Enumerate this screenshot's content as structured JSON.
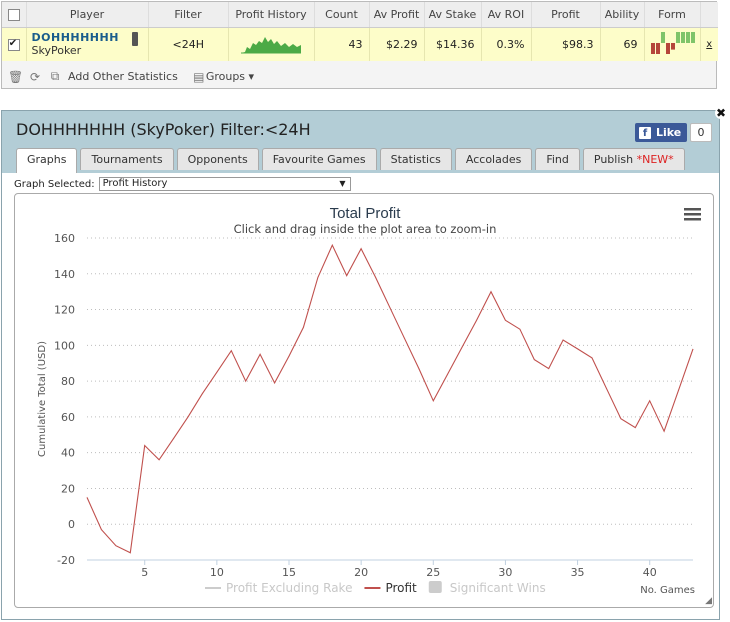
{
  "table": {
    "headers": [
      "",
      "Player",
      "Filter",
      "Profit History",
      "Count",
      "Av Profit",
      "Av Stake",
      "Av ROI",
      "Profit",
      "Ability",
      "Form",
      ""
    ],
    "row": {
      "player_name": "DOHHHHHHH",
      "player_site": "SkyPoker",
      "filter": "<24H",
      "count": "43",
      "av_profit": "$2.29",
      "av_stake": "$14.36",
      "av_roi": "0.3%",
      "profit": "$98.3",
      "ability": "69",
      "remove": "x",
      "form_bars": [
        {
          "value": -1,
          "color": "#b5453a"
        },
        {
          "value": -1,
          "color": "#b5453a"
        },
        {
          "value": 1,
          "color": "#7fc46a"
        },
        {
          "value": -1,
          "color": "#b5453a"
        },
        {
          "value": -0.6,
          "color": "#b5453a"
        },
        {
          "value": 1,
          "color": "#7fc46a"
        },
        {
          "value": 1,
          "color": "#7fc46a"
        },
        {
          "value": 1,
          "color": "#7fc46a"
        },
        {
          "value": 1,
          "color": "#7fc46a"
        }
      ]
    }
  },
  "toolbar": {
    "add_stats": "Add Other Statistics",
    "groups": "Groups ▾"
  },
  "dialog": {
    "title": "DOHHHHHHH (SkyPoker) Filter:<24H",
    "like_label": "Like",
    "like_count": "0",
    "close": "✖",
    "tabs": [
      {
        "label": "Graphs",
        "active": true
      },
      {
        "label": "Tournaments"
      },
      {
        "label": "Opponents"
      },
      {
        "label": "Favourite Games"
      },
      {
        "label": "Statistics"
      },
      {
        "label": "Accolades"
      },
      {
        "label": "Find"
      },
      {
        "label": "Publish",
        "badge": "*NEW*"
      }
    ],
    "graph_select_label": "Graph Selected:",
    "graph_select_value": "Profit History"
  },
  "chart_data": {
    "type": "line",
    "title": "Total Profit",
    "subtitle": "Click and drag inside the plot area to zoom-in",
    "xlabel": "No. Games",
    "ylabel": "Cumulative Total (USD)",
    "xlim": [
      1,
      43
    ],
    "ylim": [
      -20,
      160
    ],
    "xticks": [
      5,
      10,
      15,
      20,
      25,
      30,
      35,
      40
    ],
    "yticks": [
      -20,
      0,
      20,
      40,
      60,
      80,
      100,
      120,
      140,
      160
    ],
    "grid": true,
    "legend_position": "bottom",
    "series": [
      {
        "name": "Profit Excluding Rake",
        "color": "#cccccc",
        "visible": false,
        "values": []
      },
      {
        "name": "Profit",
        "color": "#c0504d",
        "visible": true,
        "x": [
          1,
          2,
          3,
          4,
          5,
          6,
          7,
          8,
          9,
          10,
          11,
          12,
          13,
          14,
          15,
          16,
          17,
          18,
          19,
          20,
          21,
          22,
          23,
          24,
          25,
          26,
          27,
          28,
          29,
          30,
          31,
          32,
          33,
          34,
          35,
          36,
          37,
          38,
          39,
          40,
          41,
          42,
          43
        ],
        "values": [
          15,
          -3,
          -12,
          -16,
          44,
          36,
          48,
          60,
          73,
          85,
          97,
          80,
          95,
          79,
          94,
          110,
          138,
          156,
          139,
          154,
          138,
          121,
          104,
          87,
          69,
          84,
          99,
          114,
          130,
          114,
          109,
          92,
          87,
          103,
          98,
          93,
          76,
          59,
          54,
          69,
          52,
          75,
          98
        ]
      },
      {
        "name": "Significant Wins",
        "color": "#cccccc",
        "visible": false,
        "values": []
      }
    ]
  }
}
